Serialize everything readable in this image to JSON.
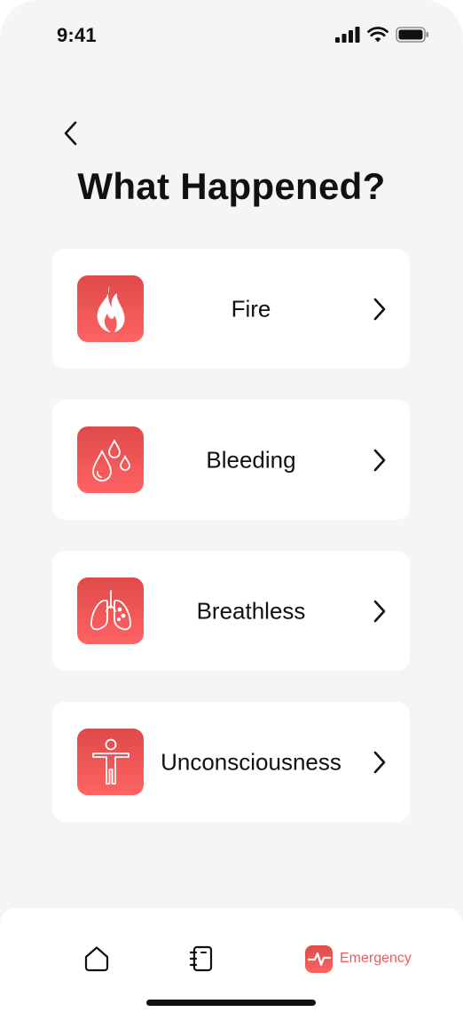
{
  "status_bar": {
    "time": "9:41"
  },
  "header": {
    "title": "What Happened?"
  },
  "options": [
    {
      "label": "Fire",
      "icon": "fire-icon"
    },
    {
      "label": "Bleeding",
      "icon": "blood-drops-icon"
    },
    {
      "label": "Breathless",
      "icon": "lungs-icon"
    },
    {
      "label": "Unconsciousness",
      "icon": "person-icon"
    }
  ],
  "tab_bar": {
    "home_icon": "home-icon",
    "notes_icon": "notebook-icon",
    "emergency_label": "Emergency",
    "emergency_icon": "heartbeat-icon"
  },
  "colors": {
    "accent": "#f05a5a",
    "accent_dark": "#df4a4a",
    "background": "#f4f5f7",
    "card": "#ffffff"
  }
}
